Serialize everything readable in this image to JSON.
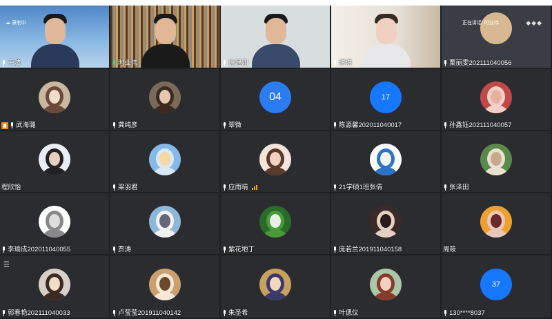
{
  "top_row": [
    {
      "name": "于波",
      "status": "录制中",
      "mic": "white"
    },
    {
      "name": "时业伟",
      "mic": "green"
    },
    {
      "name": "徐建刚",
      "mic": "white"
    },
    {
      "name": "琪琪",
      "mic": "white"
    },
    {
      "name": "粟丽雯202111040056",
      "speaking_label": "正在讲话: 时业伟",
      "mic": "white"
    }
  ],
  "rows": [
    [
      {
        "name": "武海璐",
        "avatar": "image",
        "hand": true
      },
      {
        "name": "龚纯彦",
        "avatar": "image"
      },
      {
        "name": "翠微",
        "avatar": "number",
        "avatar_text": "04"
      },
      {
        "name": "陈源馨202011040017",
        "avatar": "number",
        "avatar_text": "17"
      },
      {
        "name": "孙鑫钰202111040057",
        "avatar": "image"
      }
    ],
    [
      {
        "name": "程欣怡",
        "avatar": "image",
        "no_mic": true
      },
      {
        "name": "梁羽君",
        "avatar": "image"
      },
      {
        "name": "应雨晴",
        "avatar": "image",
        "signal": true
      },
      {
        "name": "21学硕1班张倩",
        "avatar": "image"
      },
      {
        "name": "张泽田",
        "avatar": "image"
      }
    ],
    [
      {
        "name": "李瑜成202011040055",
        "avatar": "image"
      },
      {
        "name": "贾涛",
        "avatar": "image"
      },
      {
        "name": "紫花地丁",
        "avatar": "image"
      },
      {
        "name": "庞若兰201911040158",
        "avatar": "image"
      },
      {
        "name": "周筱",
        "avatar": "image",
        "no_mic": true
      }
    ],
    [
      {
        "name": "郭春艳202111040033",
        "avatar": "image"
      },
      {
        "name": "卢莹莹201911040142",
        "avatar": "image"
      },
      {
        "name": "朱圣希",
        "avatar": "image"
      },
      {
        "name": "叶偲仪",
        "avatar": "image"
      },
      {
        "name": "130****8037",
        "avatar": "number",
        "avatar_text": "37"
      }
    ]
  ],
  "colors": {
    "tile_bg": "#2b2c30",
    "number_avatar": "#1677ff",
    "speaking_green": "#4cd964"
  }
}
